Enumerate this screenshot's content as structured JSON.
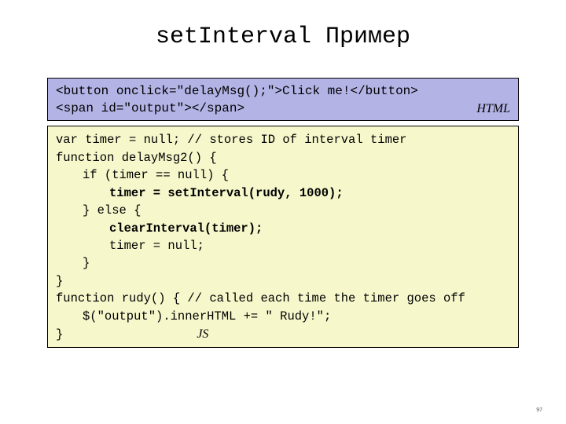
{
  "title": "setInterval Пример",
  "htmlBox": {
    "line1": "<button onclick=\"delayMsg();\">Click me!</button>",
    "line2": "<span id=\"output\"></span>",
    "badge": "HTML"
  },
  "jsBox": {
    "l1": "var timer = null; // stores ID of interval timer",
    "l2": "function delayMsg2() {",
    "l3": "if (timer == null) {",
    "l4": "timer = setInterval(rudy, 1000);",
    "l5": "} else {",
    "l6": "clearInterval(timer);",
    "l7": "timer = null;",
    "l8": "}",
    "l9": "}",
    "l10": "function rudy() { // called each time the timer goes off",
    "l11": "$(\"output\").innerHTML += \" Rudy!\";",
    "l12": "}",
    "badge": "JS"
  },
  "pageNumber": "97"
}
